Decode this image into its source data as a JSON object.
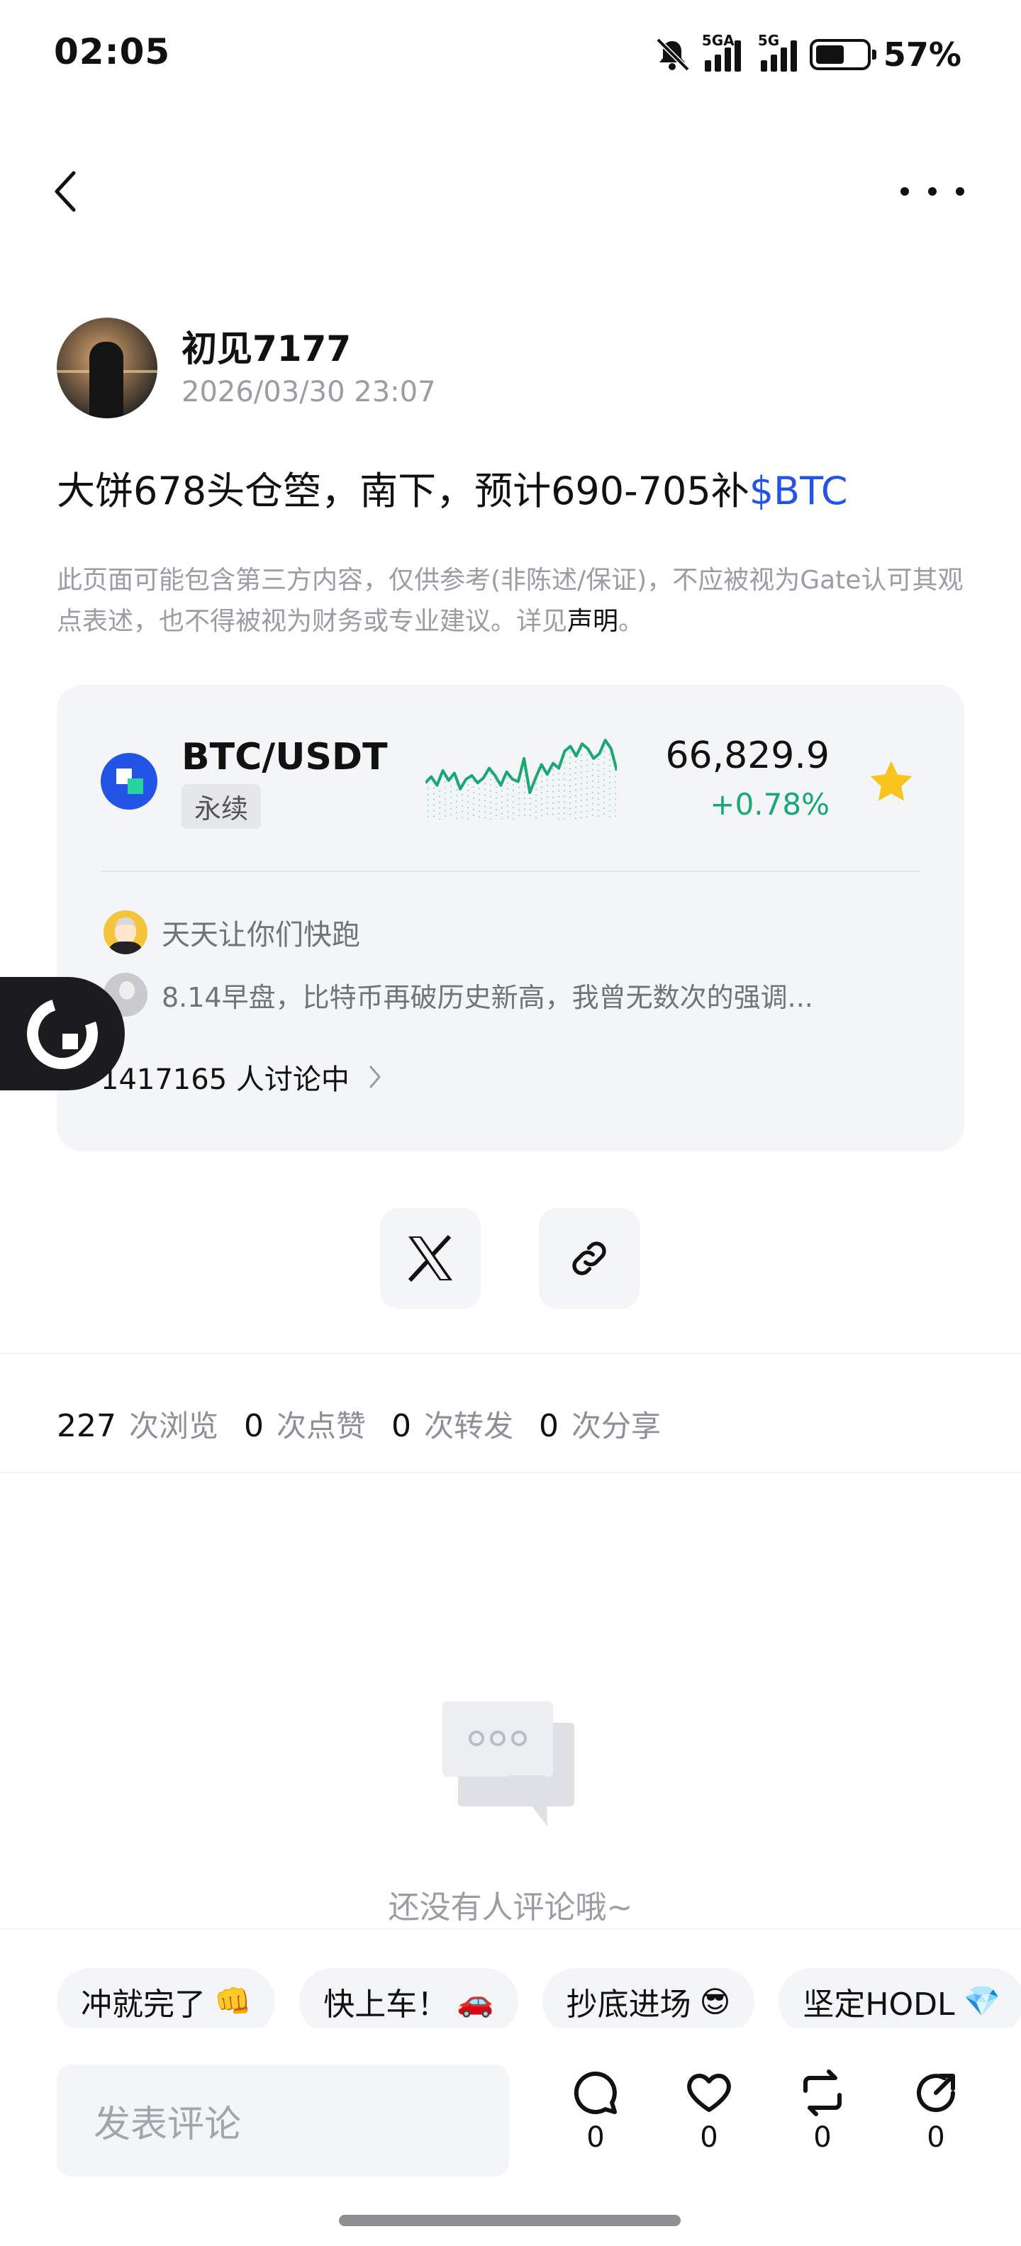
{
  "status_bar": {
    "time": "02:05",
    "signal1_tag": "5GA",
    "signal2_tag": "5G",
    "battery_percent": "57%",
    "battery_level": 0.57,
    "icons": [
      "mute-bell-icon",
      "signal-icon",
      "signal-icon",
      "battery-icon"
    ]
  },
  "nav": {
    "back_icon": "back-chevron-icon",
    "more_icon": "more-dots-icon"
  },
  "post": {
    "author_name": "初见7177",
    "timestamp": "2026/03/30 23:07",
    "text_main": "大饼678头仓箜，南下，预计690-705补",
    "text_ticker": "$BTC",
    "disclaimer_text": "此页面可能包含第三方内容，仅供参考(非陈述/保证)，不应被视为Gate认可其观点表述，也不得被视为财务或专业建议。详见",
    "disclaimer_link": "声明",
    "disclaimer_end": "。"
  },
  "market_card": {
    "pair": "BTC/USDT",
    "badge": "永续",
    "price": "66,829.9",
    "change": "+0.78%",
    "change_color": "#19a774",
    "favorite_icon": "star-icon",
    "sparkline_values": [
      50,
      45,
      52,
      40,
      48,
      42,
      55,
      47,
      44,
      50,
      46,
      38,
      44,
      52,
      41,
      47,
      49,
      30,
      58,
      46,
      35,
      43,
      34,
      38,
      24,
      20,
      28,
      18,
      22,
      30,
      26,
      15,
      22,
      40
    ],
    "discussions": [
      {
        "user": "天天让你们快跑",
        "text": ""
      },
      {
        "user": "",
        "text": "8.14早盘，比特币再破历史新高，我曾无数次的强调..."
      }
    ],
    "discussing_count": "1417165 人讨论中"
  },
  "share": {
    "x_icon": "x-logo-icon",
    "link_icon": "link-icon"
  },
  "stats": [
    {
      "num": "227",
      "label": "次浏览"
    },
    {
      "num": "0",
      "label": "次点赞"
    },
    {
      "num": "0",
      "label": "次转发"
    },
    {
      "num": "0",
      "label": "次分享"
    }
  ],
  "empty_state": {
    "icon": "chat-bubble-icon",
    "text": "还没有人评论哦~"
  },
  "quick_replies": [
    {
      "label": "冲就完了",
      "emoji": "👊"
    },
    {
      "label": "快上车！",
      "emoji": "🚗"
    },
    {
      "label": "抄底进场",
      "emoji": "😎"
    },
    {
      "label": "坚定HODL",
      "emoji": "💎"
    }
  ],
  "bottom_bar": {
    "input_placeholder": "发表评论",
    "comment_count": "0",
    "like_count": "0",
    "repost_count": "0",
    "share_count": "0"
  },
  "colors": {
    "accent_blue": "#2354e6",
    "positive_green": "#19a774",
    "star_yellow": "#f8c31c"
  }
}
